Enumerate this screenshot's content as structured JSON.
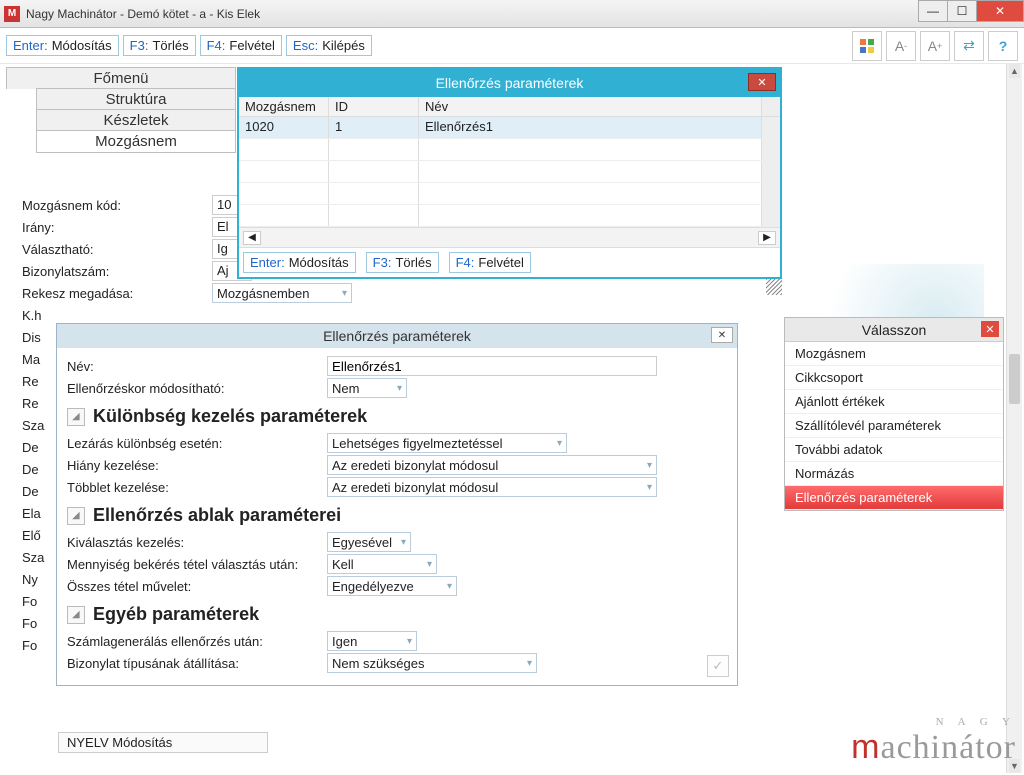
{
  "window": {
    "title": "Nagy Machinátor - Demó kötet - a - Kis Elek"
  },
  "shortcuts": {
    "enter_key": "Enter:",
    "enter_lbl": "Módosítás",
    "f3_key": "F3:",
    "f3_lbl": "Törlés",
    "f4_key": "F4:",
    "f4_lbl": "Felvétel",
    "esc_key": "Esc:",
    "esc_lbl": "Kilépés"
  },
  "tabs": [
    "Főmenü",
    "Struktúra",
    "Készletek",
    "Mozgásnem"
  ],
  "form": {
    "kod_lbl": "Mozgásnem kód:",
    "kod_val": "10",
    "irany_lbl": "Irány:",
    "irany_val": "El",
    "val_lbl": "Választható:",
    "val_val": "Ig",
    "biz_lbl": "Bizonylatszám:",
    "biz_val": "Aj",
    "rek_lbl": "Rekesz megadása:",
    "rek_val": "Mozgásnemben",
    "rows": [
      "K.h",
      "Dis",
      "Ma",
      "Re",
      "Re",
      "Sza",
      "De",
      "De",
      "De",
      "Ela",
      "Elő",
      "Sza",
      "Ny",
      "Fo",
      "Fo",
      "Fo"
    ]
  },
  "dialog1": {
    "title": "Ellenőrzés paraméterek",
    "columns": [
      "Mozgásnem",
      "ID",
      "Név"
    ],
    "row": {
      "c1": "1020",
      "c2": "1",
      "c3": "Ellenőrzés1"
    },
    "status": {
      "enter_key": "Enter:",
      "enter_lbl": "Módosítás",
      "f3_key": "F3:",
      "f3_lbl": "Törlés",
      "f4_key": "F4:",
      "f4_lbl": "Felvétel"
    }
  },
  "dialog2": {
    "title": "Ellenőrzés paraméterek",
    "nev_lbl": "Név:",
    "nev_val": "Ellenőrzés1",
    "mod_lbl": "Ellenőrzéskor módosítható:",
    "mod_val": "Nem",
    "sec1": "Különbség kezelés paraméterek",
    "lez_lbl": "Lezárás különbség esetén:",
    "lez_val": "Lehetséges figyelmeztetéssel",
    "hiany_lbl": "Hiány kezelése:",
    "hiany_val": "Az eredeti bizonylat módosul",
    "tob_lbl": "Többlet kezelése:",
    "tob_val": "Az eredeti bizonylat módosul",
    "sec2": "Ellenőrzés ablak paraméterei",
    "kiv_lbl": "Kiválasztás kezelés:",
    "kiv_val": "Egyesével",
    "menny_lbl": "Mennyiség bekérés tétel választás után:",
    "menny_val": "Kell",
    "ossz_lbl": "Összes tétel művelet:",
    "ossz_val": "Engedélyezve",
    "sec3": "Egyéb paraméterek",
    "szam_lbl": "Számlagenerálás ellenőrzés után:",
    "szam_val": "Igen",
    "biztip_lbl": "Bizonylat típusának átállítása:",
    "biztip_val": "Nem szükséges"
  },
  "chooser": {
    "title": "Válasszon",
    "items": [
      "Mozgásnem",
      "Cikkcsoport",
      "Ajánlott értékek",
      "Szállítólevél paraméterek",
      "További adatok",
      "Normázás",
      "Ellenőrzés paraméterek"
    ],
    "selected_index": 6
  },
  "nyelv": "NYELV Módosítás",
  "brand_small": "N A G Y",
  "brand": "machinátor"
}
